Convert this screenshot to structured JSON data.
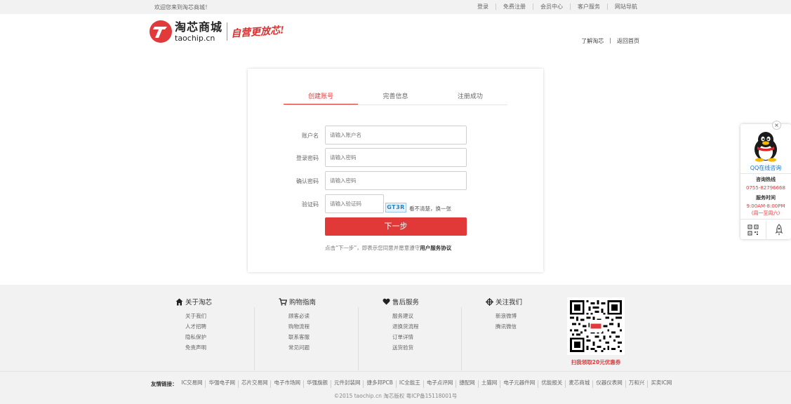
{
  "topbar": {
    "welcome": "欢迎您来到淘芯商城！",
    "links": [
      "登录",
      "免费注册",
      "会员中心",
      "客户服务",
      "网站导航"
    ]
  },
  "header": {
    "logo_cn": "淘芯商城",
    "logo_en": "taochip.cn",
    "slogan": "自营更放芯!",
    "links": [
      "了解淘芯",
      "返回首页"
    ]
  },
  "steps": [
    "创建账号",
    "完善信息",
    "注册成功"
  ],
  "form": {
    "username": {
      "label": "账户名",
      "placeholder": "请输入账户名"
    },
    "password": {
      "label": "登录密码",
      "placeholder": "请输入密码"
    },
    "confirm": {
      "label": "确认密码",
      "placeholder": "请输入密码"
    },
    "captcha": {
      "label": "验证码",
      "placeholder": "请输入验证码",
      "code": "GT3R",
      "refresh": "看不清楚，换一张"
    },
    "next_button": "下一步",
    "agreement_prefix": "点击“下一步”，即表示您同意并愿意遵守",
    "agreement_link": "用户服务协议"
  },
  "float_widget": {
    "close": "×",
    "qq_label": "QQ在线咨询",
    "hotline_label": "咨询热线",
    "hotline": "0755-82796668",
    "hours_label": "服务时间",
    "hours": "9:00AM-8:00PM",
    "days": "(周一至周六)"
  },
  "footer": {
    "columns": [
      {
        "title": "关于淘芯",
        "icon": "home-icon",
        "items": [
          "关于我们",
          "人才招聘",
          "隐私保护",
          "免责声明"
        ]
      },
      {
        "title": "购物指南",
        "icon": "cart-icon",
        "items": [
          "顾客必读",
          "购物流程",
          "联系客服",
          "常见问题"
        ]
      },
      {
        "title": "售后服务",
        "icon": "heart-icon",
        "items": [
          "服务建议",
          "退换货流程",
          "订单详情",
          "送货验货"
        ]
      },
      {
        "title": "关注我们",
        "icon": "crosshair-icon",
        "items": [
          "新浪微博",
          "腾讯微信"
        ]
      }
    ],
    "qr_caption": "扫我领取20元优惠券",
    "friend_links_label": "友情链接：",
    "friend_links": [
      "IC交易网",
      "华强电子网",
      "芯片交易网",
      "电子市场网",
      "华强旗舰",
      "元件封装网",
      "捷多邦PCB",
      "IC全能王",
      "电子点评网",
      "捷配网",
      "土猫网",
      "电子元器件网",
      "优能报关",
      "麦芯商城",
      "仪器仪表网",
      "万和兴",
      "买卖IC网"
    ],
    "copyright": "©2015 taochip.cn 淘芯版权 粤ICP备15118001号"
  },
  "colors": {
    "accent": "#e13838",
    "link_blue": "#1d72c6",
    "footer_bg": "#f2f2f2"
  }
}
